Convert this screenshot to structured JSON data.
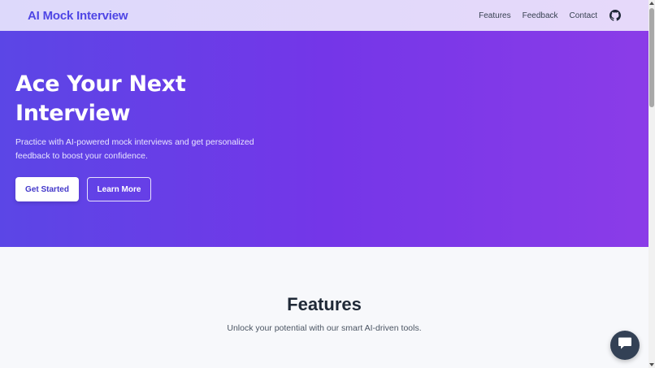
{
  "navbar": {
    "brand": "AI Mock Interview",
    "links": [
      {
        "label": "Features"
      },
      {
        "label": "Feedback"
      },
      {
        "label": "Contact"
      }
    ],
    "github_icon": "github-icon"
  },
  "hero": {
    "title": "Ace Your Next Interview",
    "subtitle": "Practice with AI-powered mock interviews and get personalized feedback to boost your confidence.",
    "primary_button": "Get Started",
    "secondary_button": "Learn More"
  },
  "features": {
    "title": "Features",
    "subtitle": "Unlock your potential with our smart AI-driven tools."
  },
  "chat": {
    "icon": "chat-icon"
  },
  "colors": {
    "brand": "#4f46e5",
    "hero_start": "#5b46e6",
    "hero_end": "#8b3ce8",
    "chat_button": "#334155"
  }
}
